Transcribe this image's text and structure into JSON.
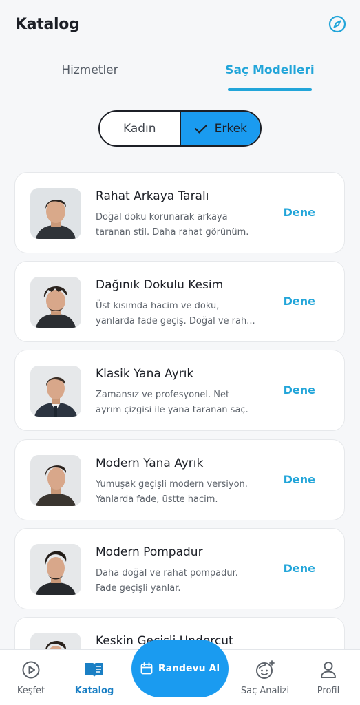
{
  "header": {
    "title": "Katalog",
    "action_icon": "compass-icon"
  },
  "tabs": [
    {
      "label": "Hizmetler",
      "active": false
    },
    {
      "label": "Saç Modelleri",
      "active": true
    }
  ],
  "gender_toggle": {
    "options": [
      {
        "label": "Kadın",
        "selected": false
      },
      {
        "label": "Erkek",
        "selected": true
      }
    ]
  },
  "styles": [
    {
      "title": "Rahat Arkaya Taralı",
      "desc_line1": "Doğal doku korunarak arkaya",
      "desc_line2": "taranan stil. Daha rahat görünüm.",
      "action": "Dene"
    },
    {
      "title": "Dağınık Dokulu Kesim",
      "desc_line1": "Üst kısımda hacim ve doku,",
      "desc_line2": "yanlarda fade geçiş. Doğal ve rah...",
      "action": "Dene"
    },
    {
      "title": "Klasik Yana Ayrık",
      "desc_line1": "Zamansız ve profesyonel. Net",
      "desc_line2": "ayrım çizgisi ile yana taranan saç.",
      "action": "Dene"
    },
    {
      "title": "Modern Yana Ayrık",
      "desc_line1": "Yumuşak geçişli modern versiyon.",
      "desc_line2": "Yanlarda fade, üstte hacim.",
      "action": "Dene"
    },
    {
      "title": "Modern Pompadur",
      "desc_line1": "Daha doğal ve rahat pompadur.",
      "desc_line2": "Fade geçişli yanlar.",
      "action": "Dene"
    },
    {
      "title": "Keskin Geçişli Undercut",
      "desc_line1": "",
      "desc_line2": "",
      "action": ""
    }
  ],
  "bottom_nav": {
    "items": [
      {
        "label": "Keşfet",
        "icon": "play-circle-icon",
        "active": false
      },
      {
        "label": "Katalog",
        "icon": "book-icon",
        "active": true
      },
      {
        "label": "Saç Analizi",
        "icon": "face-sparkle-icon",
        "active": false
      },
      {
        "label": "Profil",
        "icon": "user-icon",
        "active": false
      }
    ],
    "cta": {
      "label": "Randevu Al",
      "icon": "calendar-icon"
    }
  },
  "colors": {
    "accent": "#22a5d9",
    "primary": "#1a9bf0",
    "text": "#1c1f26",
    "muted": "#5d636b",
    "background": "#f6f7f9"
  }
}
